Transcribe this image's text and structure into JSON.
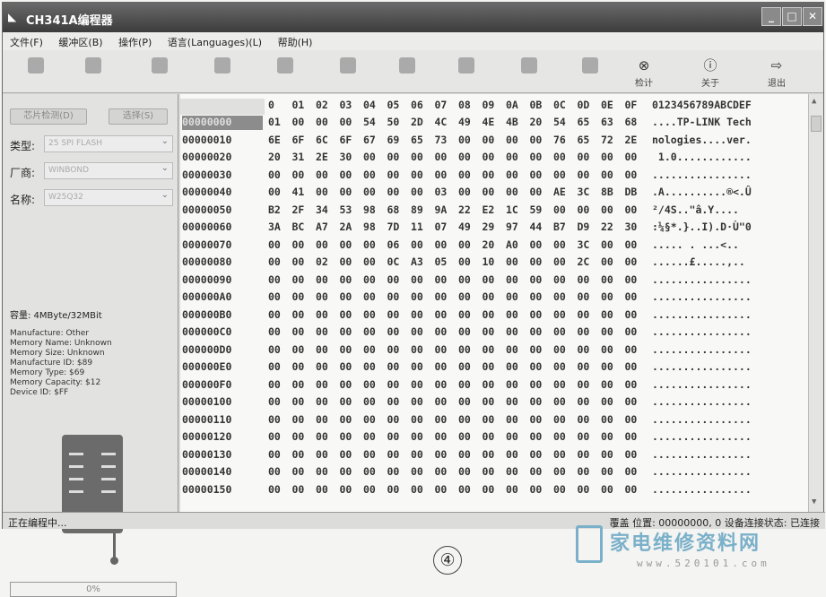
{
  "window": {
    "title": "CH341A编程器"
  },
  "menu": [
    "文件(F)",
    "缓冲区(B)",
    "操作(P)",
    "语言(Languages)(L)",
    "帮助(H)"
  ],
  "toolbar": {
    "labels": [
      "",
      "",
      "",
      "",
      "",
      "",
      "",
      "",
      "",
      "",
      "",
      "检计",
      "关于",
      "退出"
    ]
  },
  "left": {
    "btn_detect": "芯片检测(D)",
    "btn_select": "选择(S)",
    "type_label": "类型:",
    "type_value": "25 SPI FLASH",
    "maker_label": "厂商:",
    "maker_value": "WINBOND",
    "name_label": "名称:",
    "name_value": "W25Q32",
    "capacity": "容量: 4MByte/32MBit",
    "info": [
      "Manufacture: Other",
      "Memory Name: Unknown",
      "Memory Size: Unknown",
      "Manufacture ID: $89",
      "Memory Type: $69",
      "Memory Capacity: $12",
      "Device ID: $FF"
    ],
    "progress": "0%"
  },
  "hex": {
    "columns": [
      "0",
      "01",
      "02",
      "03",
      "04",
      "05",
      "06",
      "07",
      "08",
      "09",
      "0A",
      "0B",
      "0C",
      "0D",
      "0E",
      "0F"
    ],
    "ascii_header": "0123456789ABCDEF",
    "rows": [
      {
        "addr": "00000000",
        "bytes": [
          "01",
          "00",
          "00",
          "00",
          "54",
          "50",
          "2D",
          "4C",
          "49",
          "4E",
          "4B",
          "20",
          "54",
          "65",
          "63",
          "68"
        ],
        "ascii": "....TP-LINK Tech"
      },
      {
        "addr": "00000010",
        "bytes": [
          "6E",
          "6F",
          "6C",
          "6F",
          "67",
          "69",
          "65",
          "73",
          "00",
          "00",
          "00",
          "00",
          "76",
          "65",
          "72",
          "2E"
        ],
        "ascii": "nologies....ver."
      },
      {
        "addr": "00000020",
        "bytes": [
          "20",
          "31",
          "2E",
          "30",
          "00",
          "00",
          "00",
          "00",
          "00",
          "00",
          "00",
          "00",
          "00",
          "00",
          "00",
          "00"
        ],
        "ascii": " 1.0............"
      },
      {
        "addr": "00000030",
        "bytes": [
          "00",
          "00",
          "00",
          "00",
          "00",
          "00",
          "00",
          "00",
          "00",
          "00",
          "00",
          "00",
          "00",
          "00",
          "00",
          "00"
        ],
        "ascii": "................"
      },
      {
        "addr": "00000040",
        "bytes": [
          "00",
          "41",
          "00",
          "00",
          "00",
          "00",
          "00",
          "03",
          "00",
          "00",
          "00",
          "00",
          "AE",
          "3C",
          "8B",
          "DB"
        ],
        "ascii": ".A..........®<.Û"
      },
      {
        "addr": "00000050",
        "bytes": [
          "B2",
          "2F",
          "34",
          "53",
          "98",
          "68",
          "89",
          "9A",
          "22",
          "E2",
          "1C",
          "59",
          "00",
          "00",
          "00",
          "00"
        ],
        "ascii": "²/4S..\"â.Y...."
      },
      {
        "addr": "00000060",
        "bytes": [
          "3A",
          "BC",
          "A7",
          "2A",
          "98",
          "7D",
          "11",
          "07",
          "49",
          "29",
          "97",
          "44",
          "B7",
          "D9",
          "22",
          "30"
        ],
        "ascii": ":¼§*.}..I).D·Ù\"0"
      },
      {
        "addr": "00000070",
        "bytes": [
          "00",
          "00",
          "00",
          "00",
          "00",
          "06",
          "00",
          "00",
          "00",
          "20",
          "A0",
          "00",
          "00",
          "3C",
          "00",
          "00"
        ],
        "ascii": "..... . ...<.."
      },
      {
        "addr": "00000080",
        "bytes": [
          "00",
          "00",
          "02",
          "00",
          "00",
          "0C",
          "A3",
          "05",
          "00",
          "10",
          "00",
          "00",
          "00",
          "2C",
          "00",
          "00"
        ],
        "ascii": "......£.....,.."
      },
      {
        "addr": "00000090",
        "bytes": [
          "00",
          "00",
          "00",
          "00",
          "00",
          "00",
          "00",
          "00",
          "00",
          "00",
          "00",
          "00",
          "00",
          "00",
          "00",
          "00"
        ],
        "ascii": "................"
      },
      {
        "addr": "000000A0",
        "bytes": [
          "00",
          "00",
          "00",
          "00",
          "00",
          "00",
          "00",
          "00",
          "00",
          "00",
          "00",
          "00",
          "00",
          "00",
          "00",
          "00"
        ],
        "ascii": "................"
      },
      {
        "addr": "000000B0",
        "bytes": [
          "00",
          "00",
          "00",
          "00",
          "00",
          "00",
          "00",
          "00",
          "00",
          "00",
          "00",
          "00",
          "00",
          "00",
          "00",
          "00"
        ],
        "ascii": "................"
      },
      {
        "addr": "000000C0",
        "bytes": [
          "00",
          "00",
          "00",
          "00",
          "00",
          "00",
          "00",
          "00",
          "00",
          "00",
          "00",
          "00",
          "00",
          "00",
          "00",
          "00"
        ],
        "ascii": "................"
      },
      {
        "addr": "000000D0",
        "bytes": [
          "00",
          "00",
          "00",
          "00",
          "00",
          "00",
          "00",
          "00",
          "00",
          "00",
          "00",
          "00",
          "00",
          "00",
          "00",
          "00"
        ],
        "ascii": "................"
      },
      {
        "addr": "000000E0",
        "bytes": [
          "00",
          "00",
          "00",
          "00",
          "00",
          "00",
          "00",
          "00",
          "00",
          "00",
          "00",
          "00",
          "00",
          "00",
          "00",
          "00"
        ],
        "ascii": "................"
      },
      {
        "addr": "000000F0",
        "bytes": [
          "00",
          "00",
          "00",
          "00",
          "00",
          "00",
          "00",
          "00",
          "00",
          "00",
          "00",
          "00",
          "00",
          "00",
          "00",
          "00"
        ],
        "ascii": "................"
      },
      {
        "addr": "00000100",
        "bytes": [
          "00",
          "00",
          "00",
          "00",
          "00",
          "00",
          "00",
          "00",
          "00",
          "00",
          "00",
          "00",
          "00",
          "00",
          "00",
          "00"
        ],
        "ascii": "................"
      },
      {
        "addr": "00000110",
        "bytes": [
          "00",
          "00",
          "00",
          "00",
          "00",
          "00",
          "00",
          "00",
          "00",
          "00",
          "00",
          "00",
          "00",
          "00",
          "00",
          "00"
        ],
        "ascii": "................"
      },
      {
        "addr": "00000120",
        "bytes": [
          "00",
          "00",
          "00",
          "00",
          "00",
          "00",
          "00",
          "00",
          "00",
          "00",
          "00",
          "00",
          "00",
          "00",
          "00",
          "00"
        ],
        "ascii": "................"
      },
      {
        "addr": "00000130",
        "bytes": [
          "00",
          "00",
          "00",
          "00",
          "00",
          "00",
          "00",
          "00",
          "00",
          "00",
          "00",
          "00",
          "00",
          "00",
          "00",
          "00"
        ],
        "ascii": "................"
      },
      {
        "addr": "00000140",
        "bytes": [
          "00",
          "00",
          "00",
          "00",
          "00",
          "00",
          "00",
          "00",
          "00",
          "00",
          "00",
          "00",
          "00",
          "00",
          "00",
          "00"
        ],
        "ascii": "................"
      },
      {
        "addr": "00000150",
        "bytes": [
          "00",
          "00",
          "00",
          "00",
          "00",
          "00",
          "00",
          "00",
          "00",
          "00",
          "00",
          "00",
          "00",
          "00",
          "00",
          "00"
        ],
        "ascii": "................"
      }
    ]
  },
  "status": {
    "left": "正在编程中...",
    "right": "覆盖  位置: 00000000, 0  设备连接状态: 已连接"
  },
  "caption": "④",
  "watermark": {
    "name": "家电维修资料网",
    "url": "www.520101.com"
  }
}
